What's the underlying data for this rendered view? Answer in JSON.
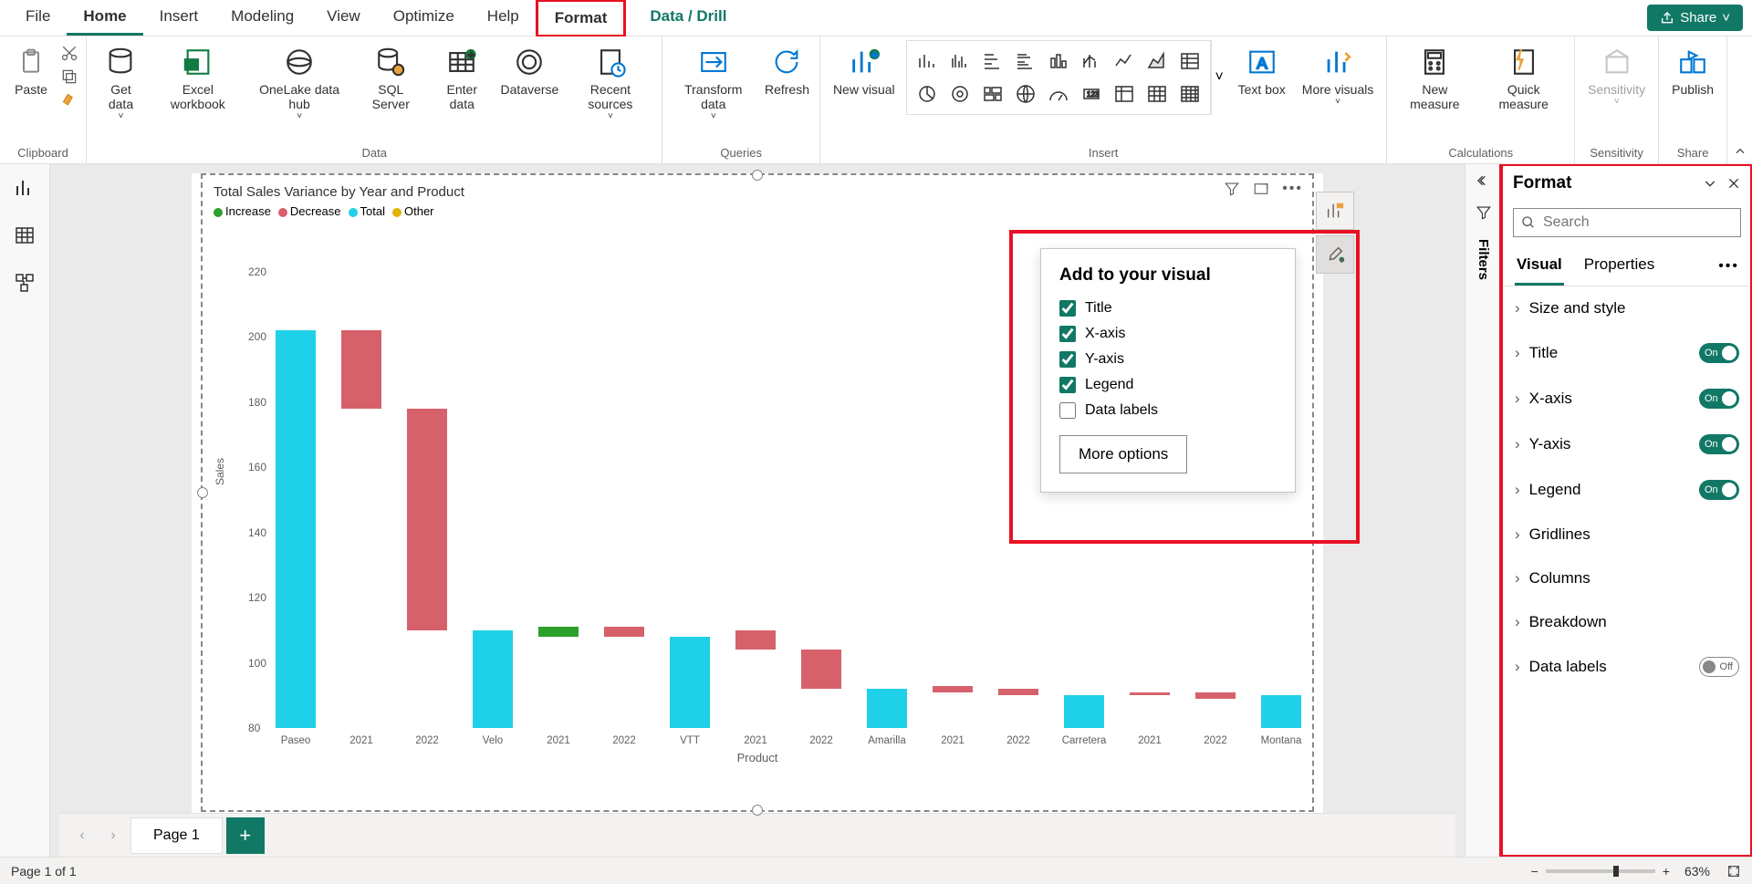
{
  "menu": {
    "items": [
      "File",
      "Home",
      "Insert",
      "Modeling",
      "View",
      "Optimize",
      "Help",
      "Format",
      "Data / Drill"
    ],
    "active": "Home",
    "highlighted": "Format",
    "share": "Share"
  },
  "ribbon": {
    "clipboard": {
      "paste": "Paste",
      "label": "Clipboard"
    },
    "data": {
      "get_data": "Get data",
      "excel": "Excel workbook",
      "onelake": "OneLake data hub",
      "sql": "SQL Server",
      "enter": "Enter data",
      "dataverse": "Dataverse",
      "recent": "Recent sources",
      "label": "Data"
    },
    "queries": {
      "transform": "Transform data",
      "refresh": "Refresh",
      "label": "Queries"
    },
    "insert": {
      "new_visual": "New visual",
      "text_box": "Text box",
      "more_visuals": "More visuals",
      "label": "Insert"
    },
    "calc": {
      "new_measure": "New measure",
      "quick": "Quick measure",
      "label": "Calculations"
    },
    "sensitivity": {
      "btn": "Sensitivity",
      "label": "Sensitivity"
    },
    "share": {
      "publish": "Publish",
      "label": "Share"
    }
  },
  "pages": {
    "tab1": "Page 1"
  },
  "filters_label": "Filters",
  "format_pane": {
    "title": "Format",
    "search_placeholder": "Search",
    "tabs": {
      "visual": "Visual",
      "properties": "Properties"
    },
    "items": [
      {
        "label": "Size and style",
        "toggle": null
      },
      {
        "label": "Title",
        "toggle": "on"
      },
      {
        "label": "X-axis",
        "toggle": "on"
      },
      {
        "label": "Y-axis",
        "toggle": "on"
      },
      {
        "label": "Legend",
        "toggle": "on"
      },
      {
        "label": "Gridlines",
        "toggle": null
      },
      {
        "label": "Columns",
        "toggle": null
      },
      {
        "label": "Breakdown",
        "toggle": null
      },
      {
        "label": "Data labels",
        "toggle": "off"
      }
    ]
  },
  "add_card": {
    "title": "Add to your visual",
    "opts": [
      {
        "label": "Title",
        "checked": true
      },
      {
        "label": "X-axis",
        "checked": true
      },
      {
        "label": "Y-axis",
        "checked": true
      },
      {
        "label": "Legend",
        "checked": true
      },
      {
        "label": "Data labels",
        "checked": false
      }
    ],
    "more": "More options"
  },
  "status": {
    "left": "Page 1 of 1",
    "zoom": "63%"
  },
  "chart_data": {
    "type": "bar",
    "title": "Total Sales Variance by Year and Product",
    "xlabel": "Product",
    "ylabel": "Sales",
    "ylim": [
      80,
      220
    ],
    "yticks": [
      80,
      100,
      120,
      140,
      160,
      180,
      200,
      220
    ],
    "legend": [
      {
        "name": "Increase",
        "color": "#2ca02c"
      },
      {
        "name": "Decrease",
        "color": "#d6616b"
      },
      {
        "name": "Total",
        "color": "#1fd1e8"
      },
      {
        "name": "Other",
        "color": "#e0b400"
      }
    ],
    "categories": [
      "Paseo",
      "2021",
      "2022",
      "Velo",
      "2021",
      "2022",
      "VTT",
      "2021",
      "2022",
      "Amarilla",
      "2021",
      "2022",
      "Carretera",
      "2021",
      "2022",
      "Montana"
    ],
    "bars": [
      {
        "from": 80,
        "to": 202,
        "color": "#1fd1e8"
      },
      {
        "from": 178,
        "to": 202,
        "color": "#d6616b"
      },
      {
        "from": 110,
        "to": 178,
        "color": "#d6616b"
      },
      {
        "from": 80,
        "to": 110,
        "color": "#1fd1e8"
      },
      {
        "from": 108,
        "to": 111,
        "color": "#2ca02c"
      },
      {
        "from": 108,
        "to": 111,
        "color": "#d6616b"
      },
      {
        "from": 80,
        "to": 108,
        "color": "#1fd1e8"
      },
      {
        "from": 104,
        "to": 110,
        "color": "#d6616b"
      },
      {
        "from": 92,
        "to": 104,
        "color": "#d6616b"
      },
      {
        "from": 80,
        "to": 92,
        "color": "#1fd1e8"
      },
      {
        "from": 91,
        "to": 93,
        "color": "#d6616b"
      },
      {
        "from": 90,
        "to": 92,
        "color": "#d6616b"
      },
      {
        "from": 80,
        "to": 90,
        "color": "#1fd1e8"
      },
      {
        "from": 90,
        "to": 91,
        "color": "#d6616b"
      },
      {
        "from": 89,
        "to": 91,
        "color": "#d6616b"
      },
      {
        "from": 80,
        "to": 90,
        "color": "#1fd1e8"
      }
    ]
  }
}
